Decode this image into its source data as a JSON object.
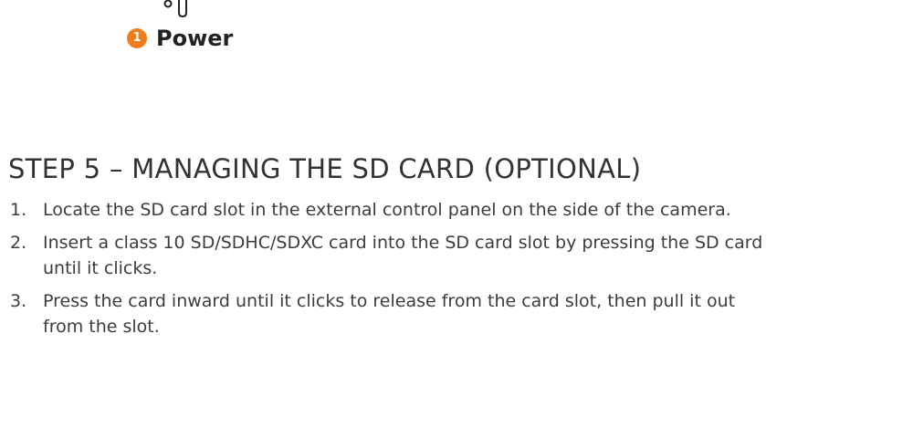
{
  "callout": {
    "number": "1",
    "label": "Power",
    "badge_color": "#f07d1b",
    "icon": "power-cable-icon"
  },
  "section": {
    "heading": "STEP 5 – MANAGING THE SD CARD (OPTIONAL)",
    "steps": [
      {
        "number": "1.",
        "text": "Locate the SD card slot in the external control panel on the side of the camera."
      },
      {
        "number": "2.",
        "text": "Insert a class 10 SD/SDHC/SDXC card into the SD card slot by pressing the SD card until it clicks."
      },
      {
        "number": "3.",
        "text": "Press the card inward until it clicks to release from the card slot, then pull it out from the slot."
      }
    ]
  }
}
